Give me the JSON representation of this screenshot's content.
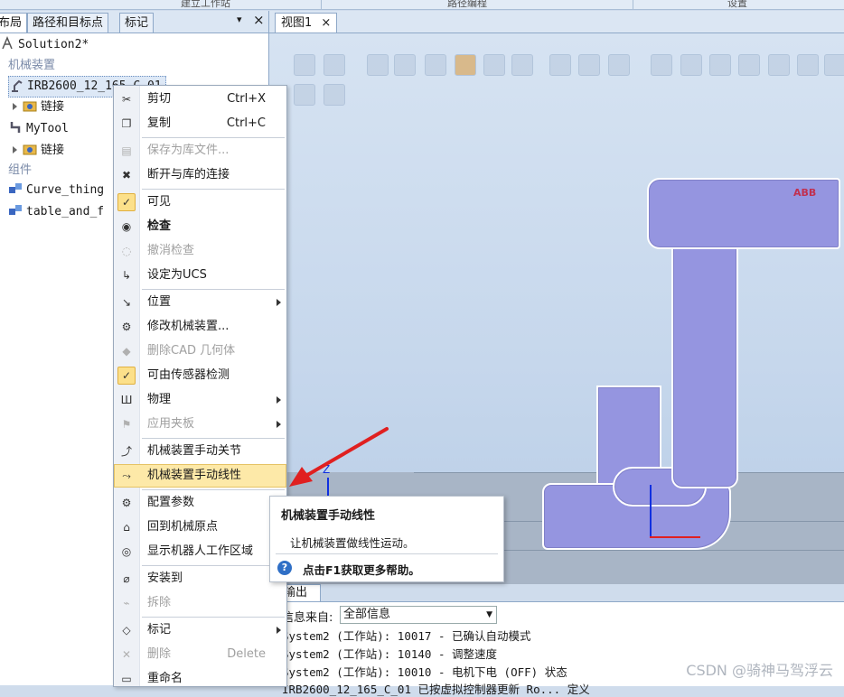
{
  "ribbon": {
    "groups": [
      "建立工作站",
      "路径编程",
      "设置"
    ]
  },
  "left_panel": {
    "tabs": [
      "布局",
      "路径和目标点",
      "标记"
    ],
    "pin_symbol": "▾",
    "close_symbol": "×",
    "tree": [
      {
        "label": "Solution2*",
        "icon": "solution-icon",
        "level": 0
      },
      {
        "label": "机械装置",
        "category": true
      },
      {
        "label": "IRB2600_12_165_C_01",
        "icon": "robot-icon",
        "level": 0,
        "selected": true
      },
      {
        "label": "链接",
        "icon": "links-folder-icon",
        "level": 1,
        "expand": true
      },
      {
        "label": "MyTool",
        "icon": "tool-icon",
        "level": 0
      },
      {
        "label": "链接",
        "icon": "links-folder-icon",
        "level": 1,
        "expand": true
      },
      {
        "label": "组件",
        "category": true
      },
      {
        "label": "Curve_thing",
        "icon": "component-icon",
        "level": 0
      },
      {
        "label": "table_and_f",
        "icon": "component-icon",
        "level": 0
      }
    ]
  },
  "view": {
    "tab_label": "视图1",
    "tab_close": "×"
  },
  "context_menu": {
    "items": [
      {
        "label": "剪切",
        "shortcut": "Ctrl+X",
        "icon": "scissors-icon"
      },
      {
        "label": "复制",
        "shortcut": "Ctrl+C",
        "icon": "copy-icon"
      },
      {
        "sep": true
      },
      {
        "label": "保存为库文件...",
        "icon": "save-library-icon",
        "disabled": true
      },
      {
        "label": "断开与库的连接",
        "icon": "disconnect-library-icon"
      },
      {
        "sep": true
      },
      {
        "label": "可见",
        "icon": "check-icon",
        "checked": true
      },
      {
        "label": "检查",
        "icon": "inspect-icon",
        "bold": true
      },
      {
        "label": "撤消检查",
        "icon": "undo-inspect-icon",
        "disabled": true
      },
      {
        "label": "设定为UCS",
        "icon": "ucs-icon"
      },
      {
        "sep": true
      },
      {
        "label": "位置",
        "icon": "position-icon",
        "submenu": true
      },
      {
        "label": "修改机械装置...",
        "icon": "modify-mechanism-icon"
      },
      {
        "label": "删除CAD 几何体",
        "icon": "delete-cad-icon",
        "disabled": true
      },
      {
        "label": "可由传感器检测",
        "icon": "check-icon",
        "checked": true
      },
      {
        "label": "物理",
        "icon": "physics-icon",
        "submenu": true
      },
      {
        "label": "应用夹板",
        "icon": "clamp-icon",
        "submenu": true,
        "disabled": true
      },
      {
        "sep": true
      },
      {
        "label": "机械装置手动关节",
        "icon": "jog-joint-icon"
      },
      {
        "label": "机械装置手动线性",
        "icon": "jog-linear-icon",
        "highlight": true
      },
      {
        "sep": true
      },
      {
        "label": "配置参数",
        "icon": "config-icon"
      },
      {
        "label": "回到机械原点",
        "icon": "home-icon"
      },
      {
        "label": "显示机器人工作区域",
        "icon": "workspace-icon"
      },
      {
        "sep": true
      },
      {
        "label": "安装到",
        "icon": "attach-icon"
      },
      {
        "label": "拆除",
        "icon": "detach-icon",
        "disabled": true
      },
      {
        "sep": true
      },
      {
        "label": "标记",
        "icon": "tag-icon",
        "submenu": true
      },
      {
        "label": "删除",
        "shortcut": "Delete",
        "icon": "delete-icon",
        "disabled": true
      },
      {
        "label": "重命名",
        "icon": "rename-icon"
      }
    ]
  },
  "tooltip": {
    "title": "机械装置手动线性",
    "description": "让机械装置做线性运动。",
    "help": "点击F1获取更多帮助。"
  },
  "output": {
    "tab_label": "输出",
    "filter_label": "信息来自:",
    "filter_value": "全部信息",
    "lines": [
      "System2 (工作站): 10017 - 已确认自动模式",
      "System2 (工作站): 10140 - 调整速度",
      "System2 (工作站): 10010 - 电机下电 (OFF) 状态",
      "IRB2600_12_165_C_01 已按虚拟控制器更新 Ro... 定义"
    ]
  },
  "watermark": "CSDN @骑神马驾浮云",
  "colors": {
    "robot": "#9595e0",
    "highlight": "#fde9a8",
    "annotation_arrow": "#e02020",
    "axis_z": "#1030e0",
    "axis_x": "#e02020"
  }
}
